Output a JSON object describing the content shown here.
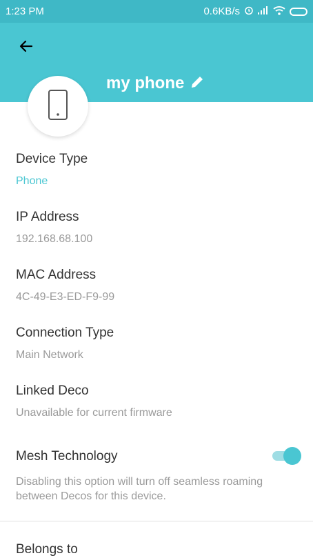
{
  "status_bar": {
    "time": "1:23 PM",
    "network_speed": "0.6KB/s",
    "icons": [
      "alarm-icon",
      "signal-icon",
      "wifi-icon",
      "battery-icon"
    ]
  },
  "header": {
    "back_icon": "arrow-left-icon",
    "device_name": "my phone",
    "edit_icon": "pencil-icon",
    "avatar_icon": "phone-icon",
    "background_color": "#4ac6d2"
  },
  "details": {
    "device_type": {
      "label": "Device Type",
      "value": "Phone"
    },
    "ip_address": {
      "label": "IP Address",
      "value": "192.168.68.100"
    },
    "mac_address": {
      "label": "MAC Address",
      "value": "4C-49-E3-ED-F9-99"
    },
    "connection_type": {
      "label": "Connection Type",
      "value": "Main Network"
    },
    "linked_deco": {
      "label": "Linked Deco",
      "value": "Unavailable for current firmware"
    },
    "mesh_technology": {
      "label": "Mesh Technology",
      "enabled": true,
      "description": "Disabling this option will turn off seamless roaming between Decos for this device."
    },
    "belongs_to": {
      "label": "Belongs to"
    }
  },
  "colors": {
    "accent": "#4ac6d2",
    "status_bar": "#3fb8c6",
    "label_text": "#333333",
    "secondary_text": "#9a9a9a"
  }
}
